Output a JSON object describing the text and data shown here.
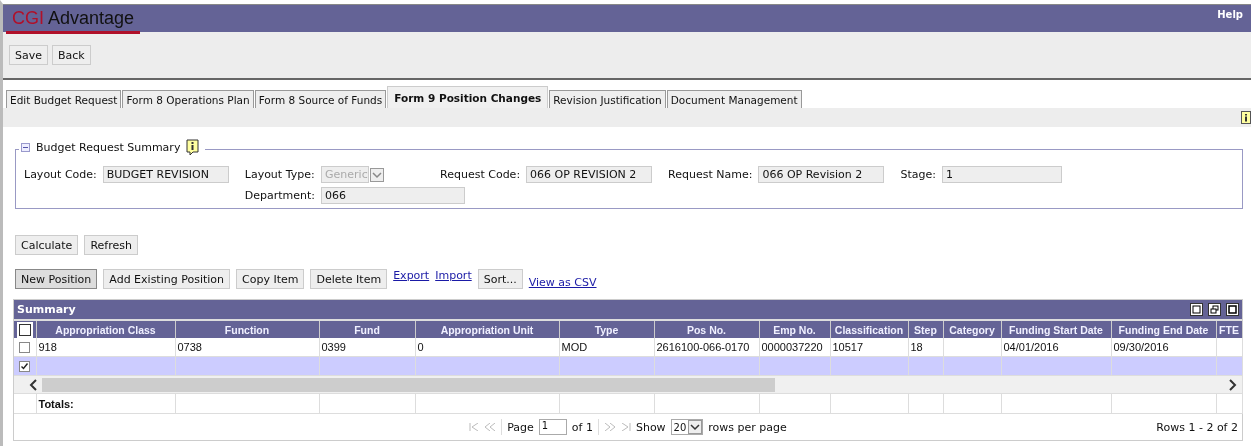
{
  "header": {
    "logo_brand": "CGI",
    "logo_product": "Advantage",
    "help": "Help"
  },
  "toolbar": [
    "Save",
    "Back"
  ],
  "tabs": [
    {
      "label": "Edit Budget Request",
      "selected": false
    },
    {
      "label": "Form 8 Operations Plan",
      "selected": false
    },
    {
      "label": "Form 8 Source of Funds",
      "selected": false
    },
    {
      "label": "Form 9 Position Changes",
      "selected": true
    },
    {
      "label": "Revision Justification",
      "selected": false
    },
    {
      "label": "Document Management",
      "selected": false
    }
  ],
  "summary_panel": {
    "title": "Budget Request Summary",
    "expanded": true,
    "rows": [
      [
        {
          "label": "Layout Code:",
          "value": "BUDGET REVISION",
          "kind": "text",
          "disabled": false
        },
        {
          "label": "Layout Type:",
          "value": "Generic",
          "kind": "select",
          "disabled": true
        },
        {
          "label": "Request Code:",
          "value": "066 OP REVISION 2",
          "kind": "text",
          "disabled": false
        },
        {
          "label": "Request Name:",
          "value": "066 OP Revision 2",
          "kind": "text",
          "disabled": false
        },
        {
          "label": "Stage:",
          "value": "1",
          "kind": "text",
          "disabled": false
        }
      ],
      [
        {
          "kind": "empty"
        },
        {
          "label": "Department:",
          "value": "066",
          "kind": "text",
          "disabled": false
        }
      ]
    ]
  },
  "calc_buttons": [
    "Calculate",
    "Refresh"
  ],
  "grid_actions": [
    {
      "kind": "button",
      "label": "New Position"
    },
    {
      "kind": "button",
      "label": "Add Existing Position"
    },
    {
      "kind": "button",
      "label": "Copy Item"
    },
    {
      "kind": "button",
      "label": "Delete Item"
    },
    {
      "kind": "link",
      "label": "Export"
    },
    {
      "kind": "link",
      "label": "Import"
    },
    {
      "kind": "button",
      "label": "Sort..."
    },
    {
      "kind": "link",
      "label": "View as CSV"
    }
  ],
  "grid": {
    "title": "Summary",
    "all_checked": false,
    "columns": [
      "Appropriation Class",
      "Function",
      "Fund",
      "Appropriation Unit",
      "Type",
      "Pos No.",
      "Emp No.",
      "Classification",
      "Step",
      "Category",
      "Funding Start Date",
      "Funding End Date",
      "FTE"
    ],
    "rows": [
      {
        "selected": false,
        "cells": [
          "918",
          "0738",
          "0399",
          "0",
          "MOD",
          "2616100-066-0170",
          "0000037220",
          "10517",
          "18",
          "",
          "04/01/2016",
          "09/30/2016",
          ""
        ]
      },
      {
        "selected": true,
        "cells": [
          "",
          "",
          "",
          "",
          "",
          "",
          "",
          "",
          "",
          "",
          "",
          "",
          ""
        ]
      }
    ],
    "totals_label": "Totals:",
    "pager": {
      "page_label": "Page",
      "page": "1",
      "of": "of 1",
      "show": "Show",
      "rows_per_page": "20",
      "rows_label": "rows per page",
      "range": "Rows 1 - 2 of 2"
    }
  }
}
